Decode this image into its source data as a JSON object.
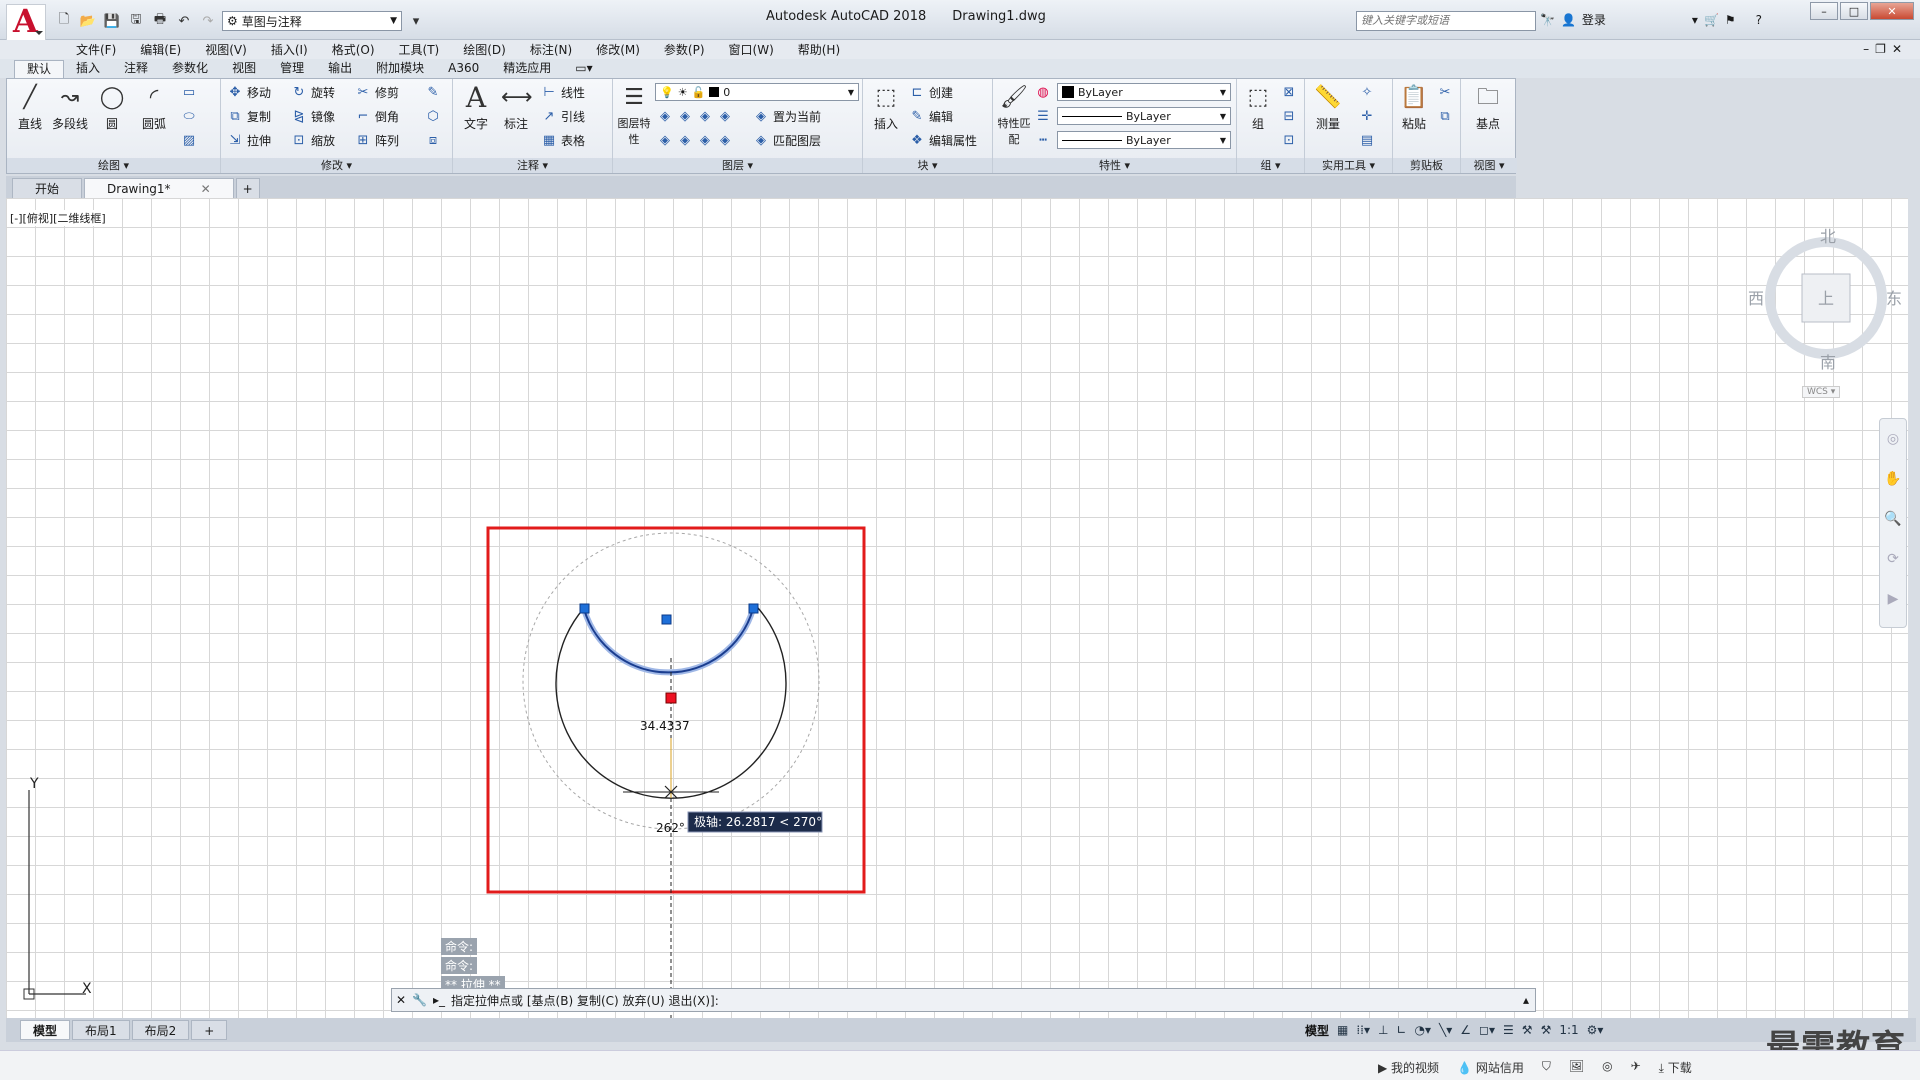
{
  "app": {
    "logo_letter": "A",
    "title": "Autodesk AutoCAD 2018",
    "filename": "Drawing1.dwg"
  },
  "workspace": {
    "value": "草图与注释"
  },
  "search": {
    "placeholder": "键入关键字或短语"
  },
  "login": {
    "label": "登录"
  },
  "menus": [
    "文件(F)",
    "编辑(E)",
    "视图(V)",
    "插入(I)",
    "格式(O)",
    "工具(T)",
    "绘图(D)",
    "标注(N)",
    "修改(M)",
    "参数(P)",
    "窗口(W)",
    "帮助(H)"
  ],
  "ribbon_tabs": [
    "默认",
    "插入",
    "注释",
    "参数化",
    "视图",
    "管理",
    "输出",
    "附加模块",
    "A360",
    "精选应用"
  ],
  "ribbon": {
    "draw": {
      "title": "绘图",
      "line": "直线",
      "polyline": "多段线",
      "circle": "圆",
      "arc": "圆弧"
    },
    "modify": {
      "title": "修改",
      "move": "移动",
      "rotate": "旋转",
      "trim": "修剪",
      "copy": "复制",
      "mirror": "镜像",
      "fillet": "倒角",
      "stretch": "拉伸",
      "scale": "缩放",
      "array": "阵列"
    },
    "annotation": {
      "title": "注释",
      "text": "文字",
      "dimension": "标注",
      "linear": "线性",
      "leader": "引线",
      "table": "表格"
    },
    "layers": {
      "title": "图层",
      "props": "图层特性",
      "current_layer": "0",
      "make_current": "置为当前",
      "match": "匹配图层"
    },
    "block": {
      "title": "块",
      "insert": "插入",
      "create": "创建",
      "edit": "编辑",
      "edit_attr": "编辑属性"
    },
    "properties": {
      "title": "特性",
      "match": "特性匹配",
      "color": "ByLayer",
      "linetype": "ByLayer",
      "lineweight": "ByLayer"
    },
    "groups": {
      "title": "组",
      "group": "组"
    },
    "utilities": {
      "title": "实用工具",
      "measure": "测量"
    },
    "clipboard": {
      "title": "剪贴板",
      "paste": "粘贴"
    },
    "view": {
      "title": "视图",
      "base": "基点"
    }
  },
  "doc_tabs": [
    {
      "label": "开始"
    },
    {
      "label": "Drawing1*"
    }
  ],
  "viewport_label": "[-][俯视][二维线框]",
  "viewcube": {
    "north": "北",
    "south": "南",
    "east": "东",
    "west": "西",
    "top": "上",
    "wcs": "WCS"
  },
  "drawing": {
    "dimension": "34.4337",
    "angle": "262°",
    "tooltip": "极轴: 26.2817 < 270°"
  },
  "command": {
    "history": [
      "命令:",
      "命令:",
      "** 拉伸 **"
    ],
    "prompt": "指定拉伸点或 [基点(B) 复制(C) 放弃(U) 退出(X)]:"
  },
  "layout_tabs": [
    "模型",
    "布局1",
    "布局2"
  ],
  "status": {
    "model": "模型",
    "scale": "1:1"
  },
  "watermark": "最需教育",
  "taskbar": [
    "我的视频",
    "网站信用",
    "下载"
  ]
}
